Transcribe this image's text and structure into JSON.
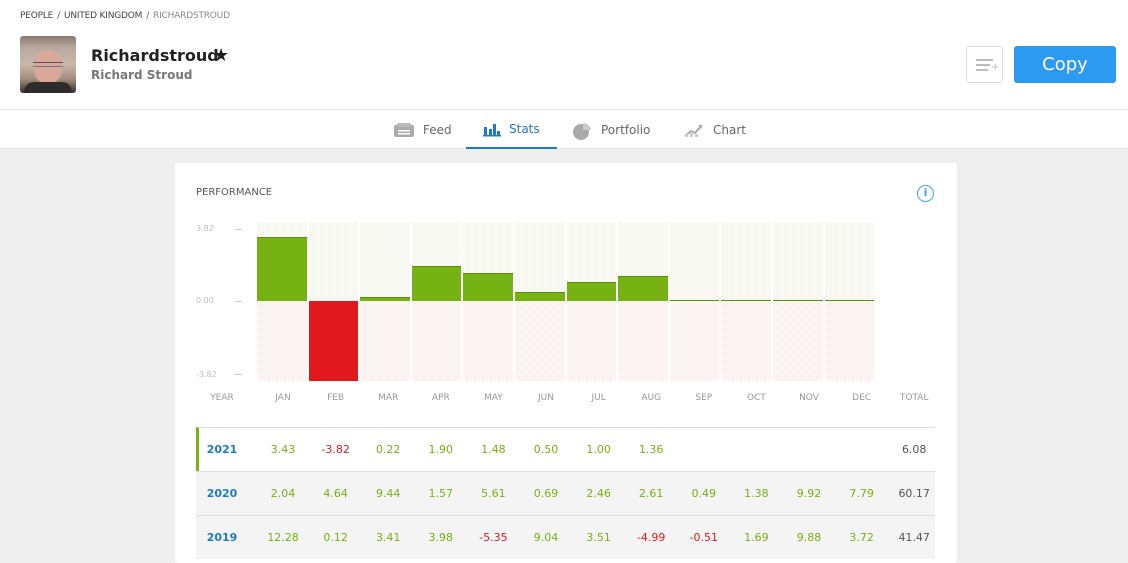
{
  "breadcrumb": [
    {
      "label": "PEOPLE"
    },
    {
      "label": "UNITED KINGDOM"
    },
    {
      "label": "RICHARDSTROUD"
    }
  ],
  "profile": {
    "username": "Richardstroud",
    "full_name": "Richard Stroud",
    "star_icon": "star-icon",
    "avatar": "user-photo"
  },
  "actions": {
    "watchlist_icon": "add-to-list-icon",
    "copy_label": "Copy"
  },
  "tabs": [
    {
      "label": "Feed",
      "icon": "feed-icon",
      "active": false
    },
    {
      "label": "Stats",
      "icon": "bar-chart-icon",
      "active": true
    },
    {
      "label": "Portfolio",
      "icon": "pie-chart-icon",
      "active": false
    },
    {
      "label": "Chart",
      "icon": "line-chart-icon",
      "active": false
    }
  ],
  "performance": {
    "title": "PERFORMANCE",
    "info_icon": "info-icon",
    "headers": [
      "YEAR",
      "JAN",
      "FEB",
      "MAR",
      "APR",
      "MAY",
      "JUN",
      "JUL",
      "AUG",
      "SEP",
      "OCT",
      "NOV",
      "DEC",
      "TOTAL"
    ],
    "rows": [
      {
        "year": "2021",
        "values": [
          "3.43",
          "-3.82",
          "0.22",
          "1.90",
          "1.48",
          "0.50",
          "1.00",
          "1.36",
          "",
          "",
          "",
          ""
        ],
        "total": "6.08",
        "current": true
      },
      {
        "year": "2020",
        "values": [
          "2.04",
          "4.64",
          "9.44",
          "1.57",
          "5.61",
          "0.69",
          "2.46",
          "2.61",
          "0.49",
          "1.38",
          "9.92",
          "7.79"
        ],
        "total": "60.17",
        "current": false
      },
      {
        "year": "2019",
        "values": [
          "12.28",
          "0.12",
          "3.41",
          "3.98",
          "-5.35",
          "9.04",
          "3.51",
          "-4.99",
          "-0.51",
          "1.69",
          "9.88",
          "3.72"
        ],
        "total": "41.47",
        "current": false
      }
    ]
  },
  "chart_data": {
    "type": "bar",
    "title": "PERFORMANCE",
    "categories": [
      "JAN",
      "FEB",
      "MAR",
      "APR",
      "MAY",
      "JUN",
      "JUL",
      "AUG",
      "SEP",
      "OCT",
      "NOV",
      "DEC"
    ],
    "values": [
      3.43,
      -3.82,
      0.22,
      1.9,
      1.48,
      0.5,
      1.0,
      1.36,
      0,
      0,
      0,
      0
    ],
    "yticks": [
      "3.82",
      "0.00",
      "-3.82"
    ],
    "ylim": [
      -3.82,
      3.82
    ],
    "xlabel": "",
    "ylabel": "",
    "colors": {
      "positive": "#75b212",
      "negative": "#e1191f"
    }
  }
}
